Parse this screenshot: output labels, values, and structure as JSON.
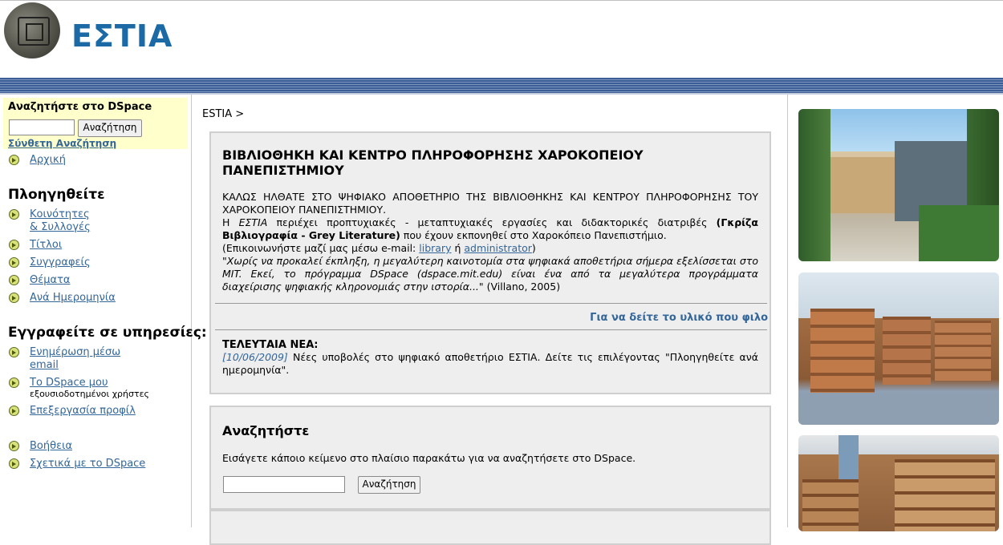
{
  "header": {
    "site_title": "ΕΣΤΙΑ"
  },
  "leftnav": {
    "search_label": "Αναζητήστε στο DSpace",
    "search_button": "Αναζήτηση",
    "advanced_search": "Σύνθετη Αναζήτηση",
    "home": "Αρχική",
    "browse_heading": "Πλοηγηθείτε",
    "browse_items": {
      "communities_line1": "Κοινότητες",
      "communities_line2": "& Συλλογές",
      "titles": "Τίτλοι",
      "authors": "Συγγραφείς",
      "subjects": "Θέματα",
      "by_date": "Ανά Ημερομηνία"
    },
    "subscribe_heading": "Εγγραφείτε σε υπηρεσίες:",
    "email_updates_line1": "Ενημέρωση μέσω ",
    "email_updates_line2": "email",
    "my_dspace": "Το DSpace μου",
    "my_dspace_sub": "εξουσιοδοτημένοι χρήστες",
    "edit_profile": "Επεξεργασία προφίλ",
    "help": "Βοήθεια",
    "about": "Σχετικά με το DSpace"
  },
  "breadcrumb": "ESTIA  >",
  "intro": {
    "title": "ΒΙΒΛΙΟΘΗΚΗ ΚΑΙ ΚΕΝΤΡΟ ΠΛΗΡΟΦΟΡΗΣΗΣ ΧΑΡΟΚΟΠΕΙΟΥ ΠΑΝΕΠΙΣΤΗΜΙΟΥ",
    "welcome": "ΚΑΛΩΣ ΗΛΘΑΤΕ ΣΤΟ ΨΗΦΙΑΚΟ ΑΠΟΘΕΤΗΡΙΟ ΤΗΣ ΒΙΒΛΙΟΘΗΚΗΣ ΚΑΙ ΚΕΝΤΡΟΥ ΠΛΗΡΟΦΟΡΗΣΗΣ ΤΟΥ ΧΑΡΟΚΟΠΕΙΟΥ ΠΑΝΕΠΙΣΤΗΜΙΟΥ.",
    "p1_pre": "Η ",
    "p1_estia": "ΕΣΤΙΑ",
    "p1_mid": " περιέχει προπτυχιακές - μεταπτυχιακές εργασίες και διδακτορικές διατριβές ",
    "p1_bold": "(Γκρίζα Βιβλιογραφία - Grey Literature)",
    "p1_post": " που έχουν εκπονηθεί στο Χαροκόπειο Πανεπιστήμιο.",
    "contact_pre": "(Επικοινωνήστε μαζί μας μέσω e-mail: ",
    "contact_library": "library",
    "contact_or": " ή ",
    "contact_admin": "administrator",
    "contact_post": ")",
    "quote": "\"Χωρίς να προκαλεί έκπληξη, η μεγαλύτερη καινοτομία στα ψηφιακά αποθετήρια σήμερα εξελίσσεται στο MIT. Εκεί, το πρόγραμμα DSpace (dspace.mit.edu) είναι ένα από τα μεγαλύτερα προγράμματα διαχείρισης ψηφιακής κληρονομιάς στην ιστορία...\"",
    "quote_source": " (Villano, 2005)",
    "more_link": "Για να δείτε το υλικό που φιλο",
    "news_title": "ΤΕΛΕΥΤΑΙΑ ΝΕΑ:",
    "news_date": "[10/06/2009]",
    "news_text": " Νέες υποβολές στο ψηφιακό αποθετήριο ΕΣΤΙΑ. Δείτε τις επιλέγοντας \"Πλοηγηθείτε ανά ημερομηνία\"."
  },
  "search_panel": {
    "title": "Αναζητήστε",
    "description": "Εισάγετε κάποιο κείμενο στο πλαίσιο παρακάτω για να αναζητήσετε στο DSpace.",
    "button": "Αναζήτηση"
  },
  "colors": {
    "brand_title": "#1b6aa5",
    "link": "#336699",
    "panel_bg": "#eeeeee",
    "search_box_bg": "#ffffcc"
  },
  "icons": [
    "logo",
    "bullet-arrow-icon",
    "campus-photo",
    "library-shelves-photo",
    "library-shelves-photo-2"
  ]
}
